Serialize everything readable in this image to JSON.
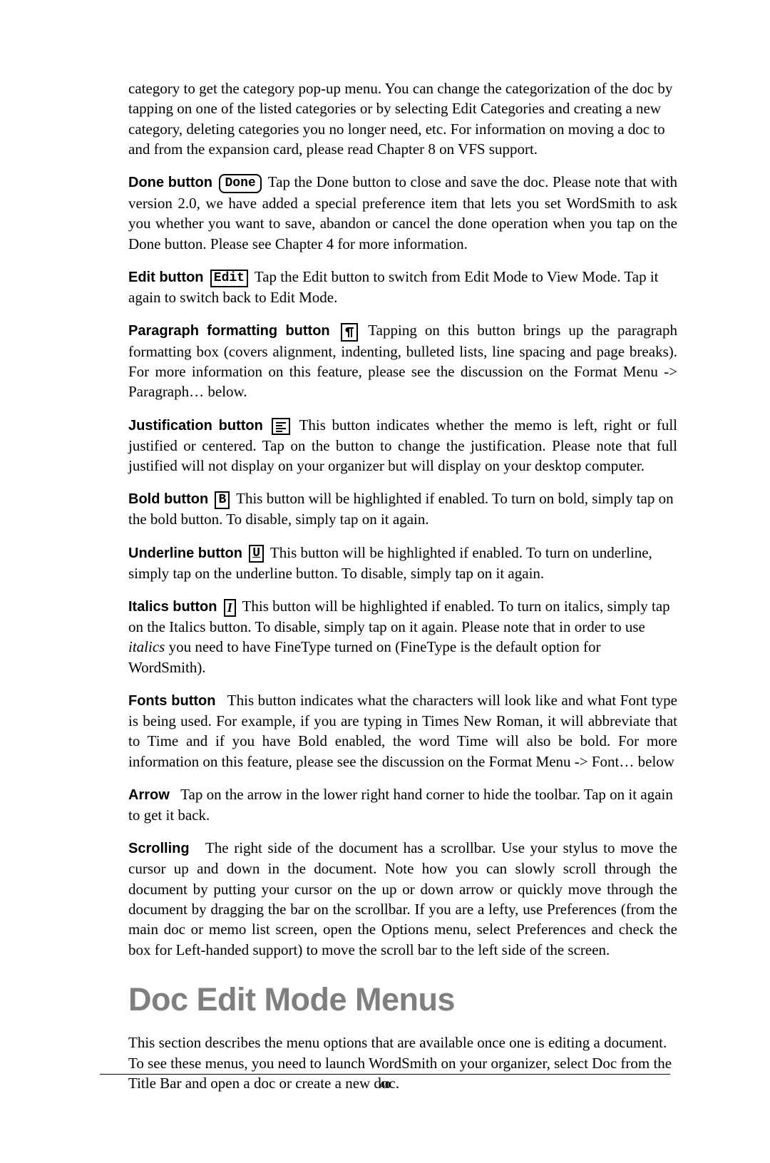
{
  "intro": "category to get the category pop-up menu.  You can change the categorization of the doc by tapping on one of the listed categories or by selecting Edit Categories and creating a new category, deleting categories you no longer need, etc.  For information on moving a doc to and from the expansion card, please read Chapter 8 on VFS support.",
  "done": {
    "label": "Done button",
    "icon_text": "Done",
    "body": "Tap the Done button to close and save the doc.  Please note that with version 2.0, we have added a special preference item that lets you set WordSmith to ask you whether you want to save, abandon or cancel the done operation when you tap on the Done button.  Please see Chapter 4 for more information."
  },
  "edit": {
    "label": "Edit button",
    "icon_text": "Edit",
    "body": "Tap the Edit button to switch from Edit Mode to View Mode.  Tap it again to switch back to Edit Mode."
  },
  "paragraph": {
    "label": "Paragraph formatting button",
    "body": "Tapping on this button brings up the paragraph formatting box (covers alignment, indenting, bulleted lists, line spacing and page breaks).  For more information on this feature, please see the discussion on the Format Menu -> Paragraph… below."
  },
  "justification": {
    "label": "Justification button",
    "body": "This button indicates whether the memo is left, right or full justified or centered.  Tap on the button to change the justification. Please note that full justified will not display on your organizer but will display on your desktop computer."
  },
  "bold": {
    "label": "Bold button",
    "icon_text": "B",
    "body": "This button will be highlighted if enabled.  To turn on bold, simply tap on the bold button.  To disable, simply tap on it again."
  },
  "underline": {
    "label": "Underline button",
    "icon_text": "U",
    "body": "This button will be highlighted if enabled.  To turn on underline, simply tap on the underline button.  To disable, simply tap on it again."
  },
  "italics": {
    "label": "Italics button",
    "icon_text": "I",
    "body_pre": "This button will be highlighted if enabled.  To turn on italics, simply tap on the Italics button.  To disable, simply tap on it again.  Please note that in order to use ",
    "body_em": "italics",
    "body_post": " you need to have FineType turned on (FineType is the default option for WordSmith)."
  },
  "fonts": {
    "label": "Fonts button",
    "body": "This button indicates what the characters will look like and what Font type is being used.  For example, if you are typing in Times New Roman, it will abbreviate that to Time and if you have Bold enabled, the word Time will also be bold. For more information on this feature, please see the discussion on the Format Menu -> Font… below"
  },
  "arrow": {
    "label": "Arrow",
    "body": "Tap on the arrow in the lower right hand corner to hide the toolbar.  Tap on it again to get it back."
  },
  "scrolling": {
    "label": "Scrolling",
    "body": "The right side of the document has a scrollbar.  Use your stylus to move the cursor up and down in the document.  Note how you can slowly scroll through the document by putting your cursor on the up or down arrow or quickly move through the document by dragging the bar on the scrollbar. If you are a lefty, use Preferences (from the main doc or memo list screen, open the Options menu, select Preferences and check the box for Left-handed support) to move the scroll bar to the left side of the screen."
  },
  "heading": "Doc Edit Mode Menus",
  "section_intro": "This section describes the menu options that are available once one is editing a document.  To see these menus, you need to launch WordSmith on your organizer, select Doc from the Title Bar and open a doc or create a new doc.",
  "page_number": "40"
}
